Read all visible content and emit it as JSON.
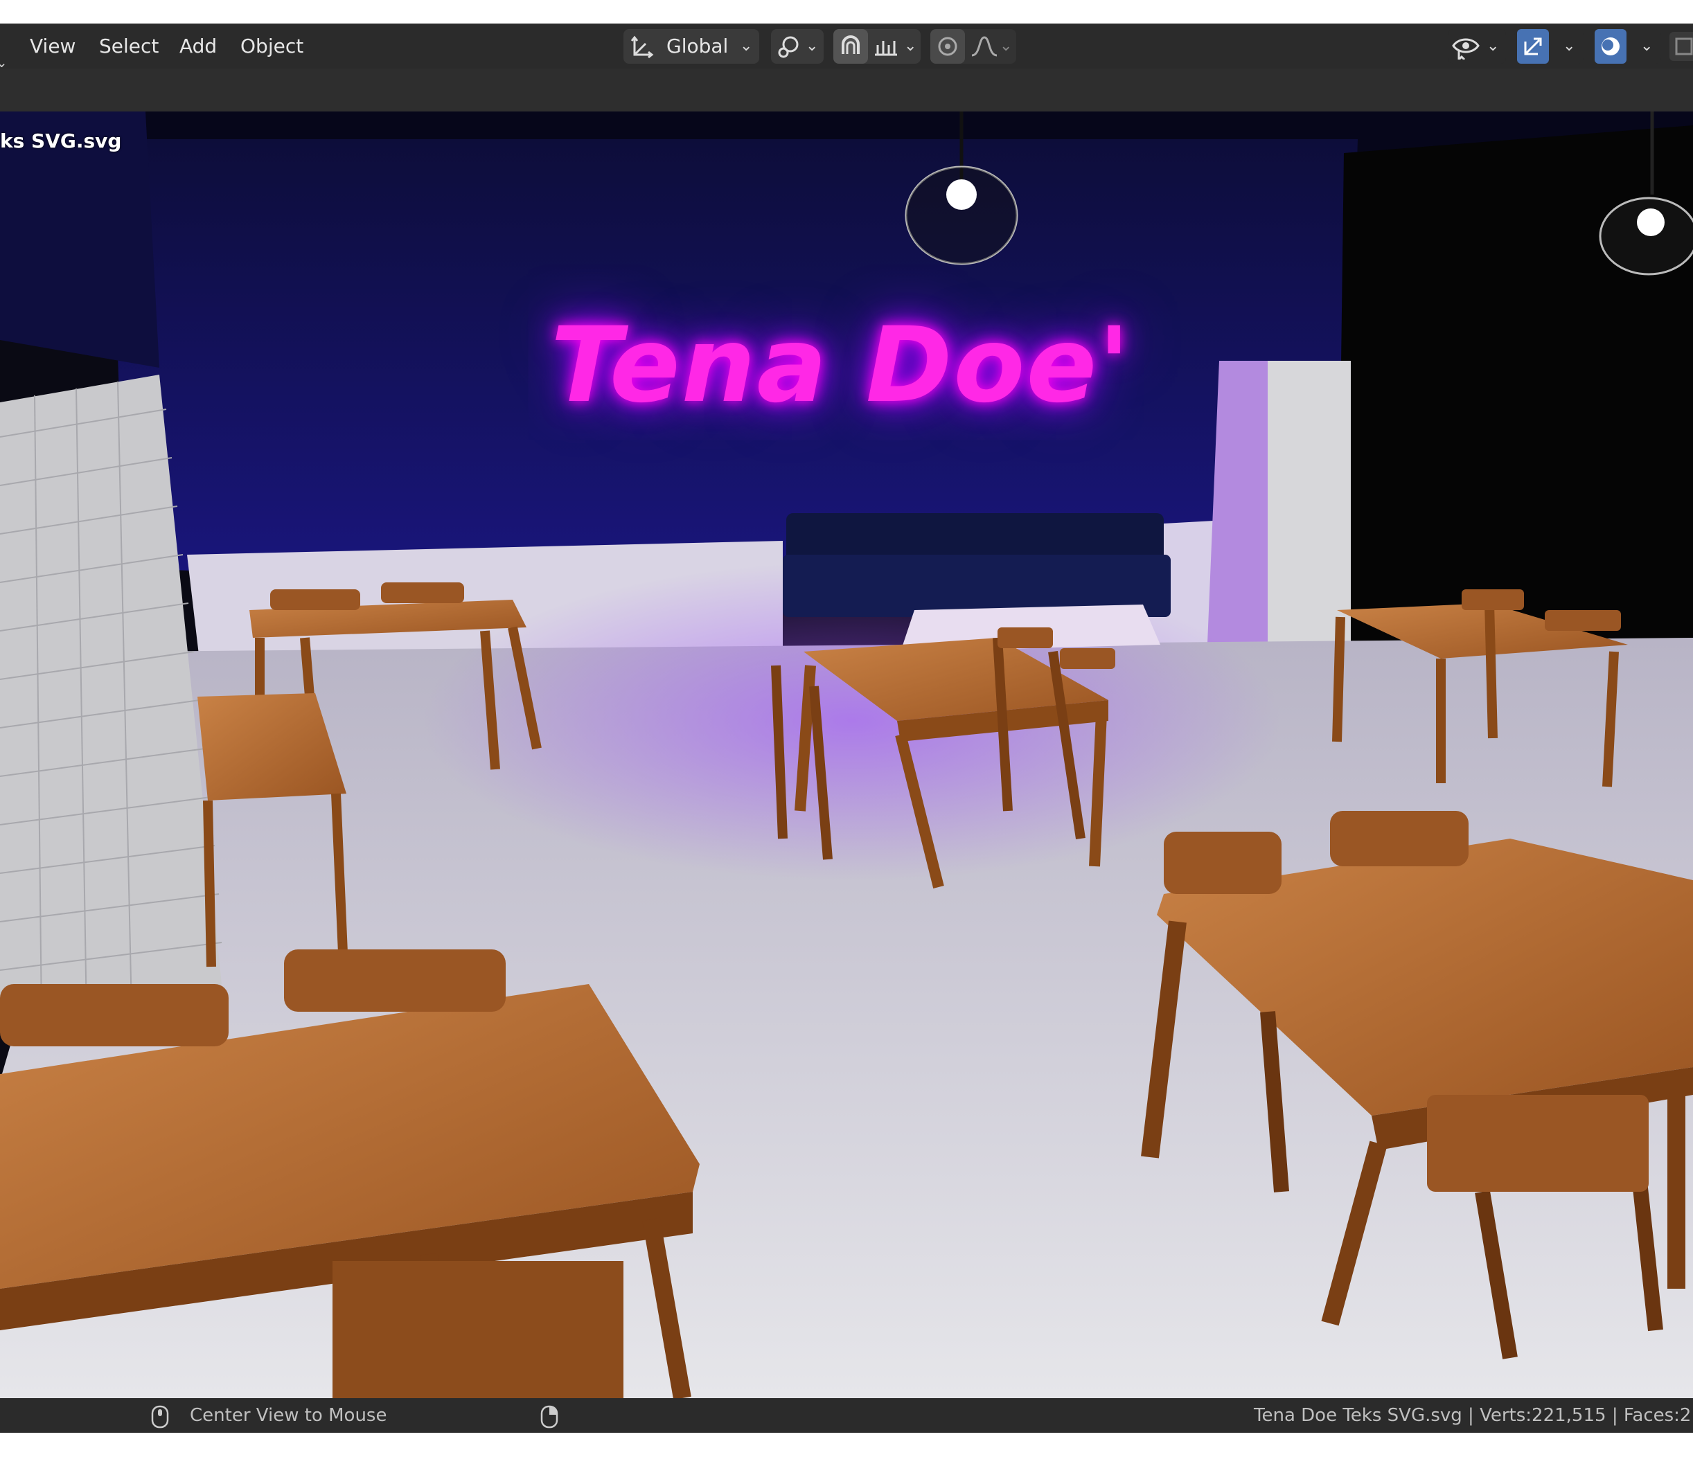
{
  "menu": {
    "view": "View",
    "select": "Select",
    "add": "Add",
    "object": "Object"
  },
  "toolbar": {
    "transform_orientation": "Global"
  },
  "viewport": {
    "file_label": "ks SVG.svg",
    "neon_sign": "Tena Doe'"
  },
  "statusbar": {
    "hint": "Center View to Mouse",
    "scene_info": "Tena Doe Teks SVG.svg | Verts:221,515 | Faces:2"
  },
  "colors": {
    "neon": "#ff28e6",
    "wall": "#0c0c4a",
    "wood": "#b8692a",
    "floor": "#d8d8dc",
    "accent_button": "#4772b3"
  }
}
